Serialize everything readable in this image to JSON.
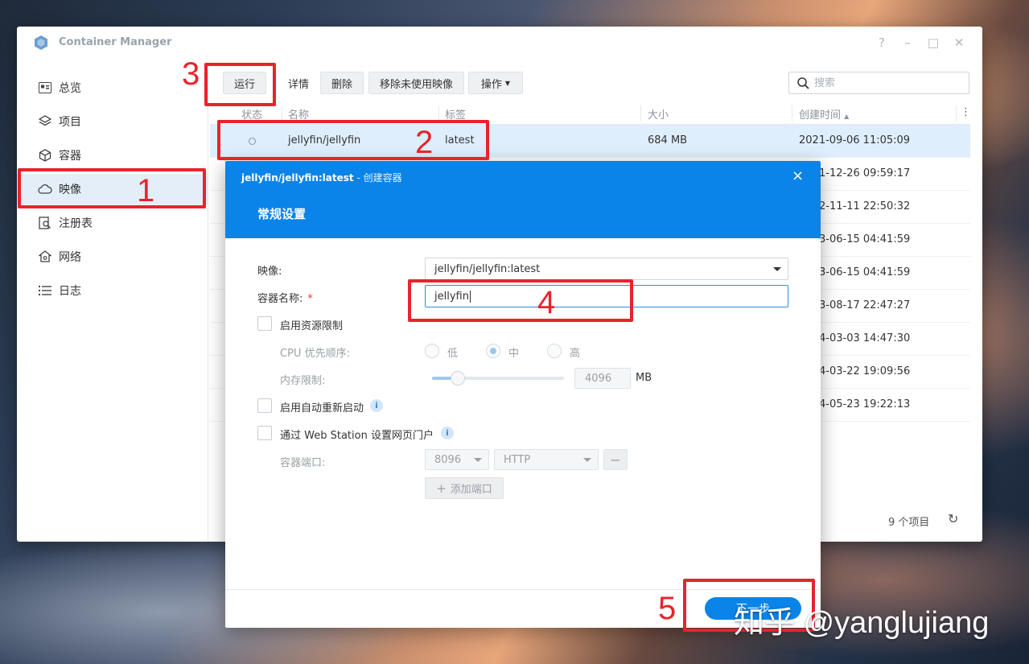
{
  "app": {
    "title": "Container Manager"
  },
  "window_controls": {
    "help": "?",
    "minimize": "–",
    "maximize": "□",
    "close": "✕"
  },
  "sidebar": {
    "items": [
      {
        "label": "总览",
        "icon": "overview-icon"
      },
      {
        "label": "项目",
        "icon": "layers-icon"
      },
      {
        "label": "容器",
        "icon": "cube-icon"
      },
      {
        "label": "映像",
        "icon": "cloud-icon",
        "active": true
      },
      {
        "label": "注册表",
        "icon": "registry-search-icon"
      },
      {
        "label": "网络",
        "icon": "network-home-icon"
      },
      {
        "label": "日志",
        "icon": "list-icon"
      }
    ]
  },
  "toolbar": {
    "run": "运行",
    "details": "详情",
    "delete": "删除",
    "remove_unused": "移除未使用映像",
    "actions": "操作"
  },
  "search": {
    "placeholder": "搜索"
  },
  "table": {
    "headers": {
      "status": "状态",
      "name": "名称",
      "tag": "标签",
      "size": "大小",
      "created": "创建时间"
    },
    "rows": [
      {
        "name": "jellyfin/jellyfin",
        "tag": "latest",
        "size": "684 MB",
        "created": "2021-09-06 11:05:09"
      },
      {
        "created": "1-12-26 09:59:17"
      },
      {
        "created": "2-11-11 22:50:32"
      },
      {
        "created": "3-06-15 04:41:59"
      },
      {
        "created": "3-06-15 04:41:59"
      },
      {
        "created": "3-08-17 22:47:27"
      },
      {
        "created": "4-03-03 14:47:30"
      },
      {
        "created": "4-03-22 19:09:56"
      },
      {
        "created": "4-05-23 19:22:13"
      }
    ],
    "count": "9 个项目"
  },
  "dialog": {
    "title": "jellyfin/jellyfin:latest",
    "subtitle": " - 创建容器",
    "close": "×",
    "step": "常规设置",
    "image_label": "映像:",
    "image_value": "jellyfin/jellyfin:latest",
    "name_label": "容器名称:",
    "required_mark": "*",
    "name_value": "jellyfin",
    "resource_limit": "启用资源限制",
    "cpu_label": "CPU 优先顺序:",
    "cpu_options": [
      "低",
      "中",
      "高"
    ],
    "cpu_selected": "中",
    "mem_label": "内存限制:",
    "mem_value": "4096",
    "mem_unit": "MB",
    "mem_fraction": 0.2,
    "auto_restart": "启用自动重新启动",
    "webstation": "通过 Web Station 设置网页门户",
    "port_label": "容器端口:",
    "port_value": "8096",
    "protocol_value": "HTTP",
    "add_port": "添加端口",
    "next": "下一步"
  },
  "annotations": {
    "n1": "1",
    "n2": "2",
    "n3": "3",
    "n4": "4",
    "n5": "5",
    "color": "#e8232c"
  },
  "watermark": "知乎 @yanglujiang"
}
